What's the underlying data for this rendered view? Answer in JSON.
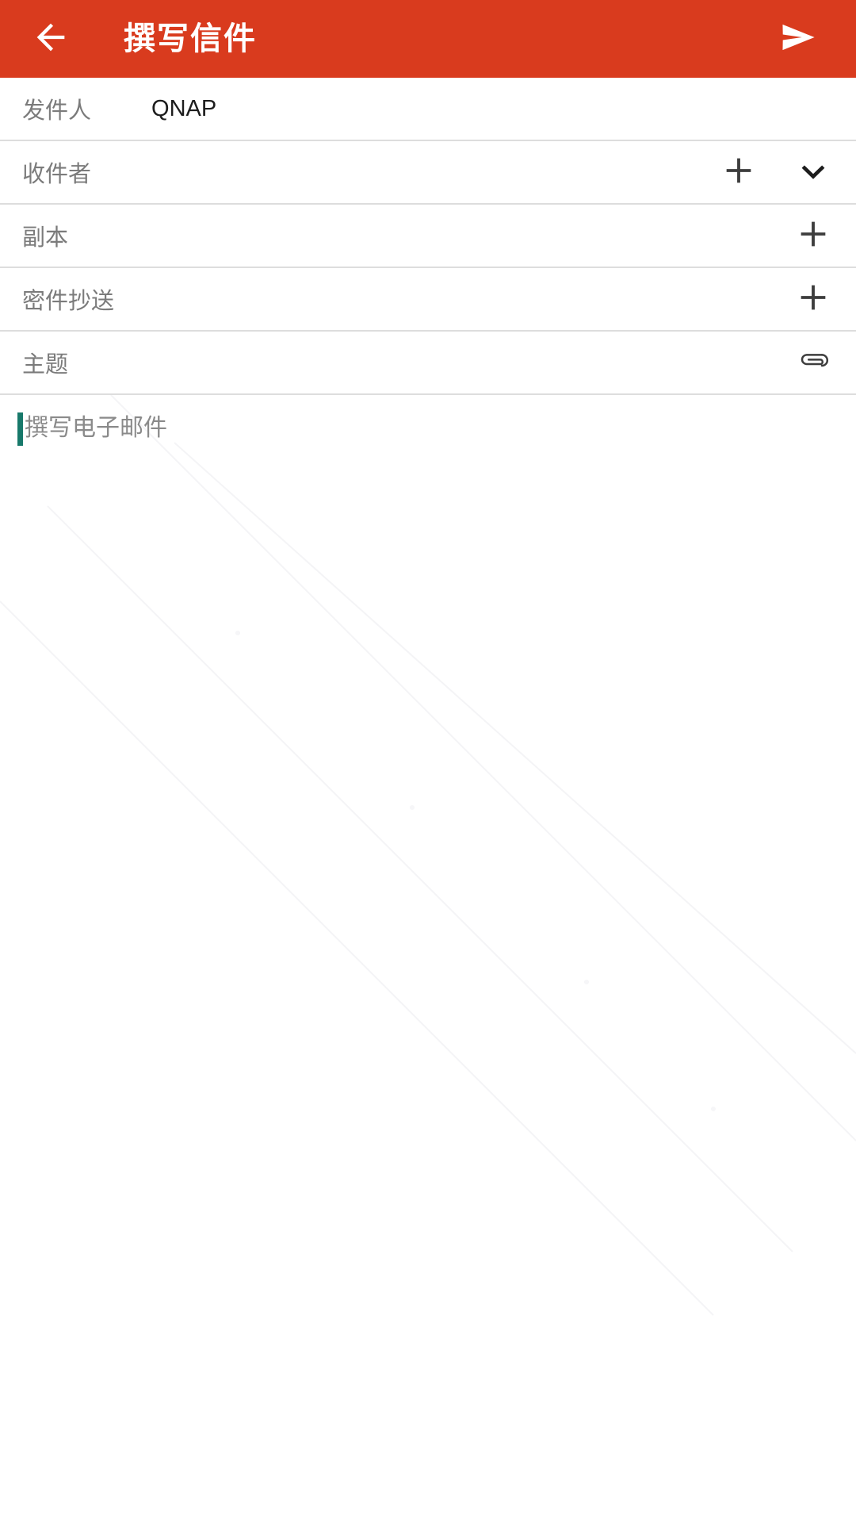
{
  "appbar": {
    "title": "撰写信件",
    "back_icon": "arrow-left-icon",
    "send_icon": "send-icon",
    "background_color": "#d93b1e",
    "foreground_color": "#ffffff"
  },
  "form": {
    "rows": [
      {
        "key": "from",
        "label": "发件人",
        "value": "QNAP",
        "actions": []
      },
      {
        "key": "to",
        "label": "收件者",
        "value": "",
        "actions": [
          "plus-icon",
          "chevron-down-icon"
        ]
      },
      {
        "key": "cc",
        "label": "副本",
        "value": "",
        "actions": [
          "plus-icon"
        ]
      },
      {
        "key": "bcc",
        "label": "密件抄送",
        "value": "",
        "actions": [
          "plus-icon"
        ]
      },
      {
        "key": "subject",
        "label": "主题",
        "value": "",
        "actions": [
          "attachment-icon"
        ]
      }
    ]
  },
  "body": {
    "placeholder": "撰写电子邮件",
    "value": "",
    "caret_color": "#18796b"
  }
}
